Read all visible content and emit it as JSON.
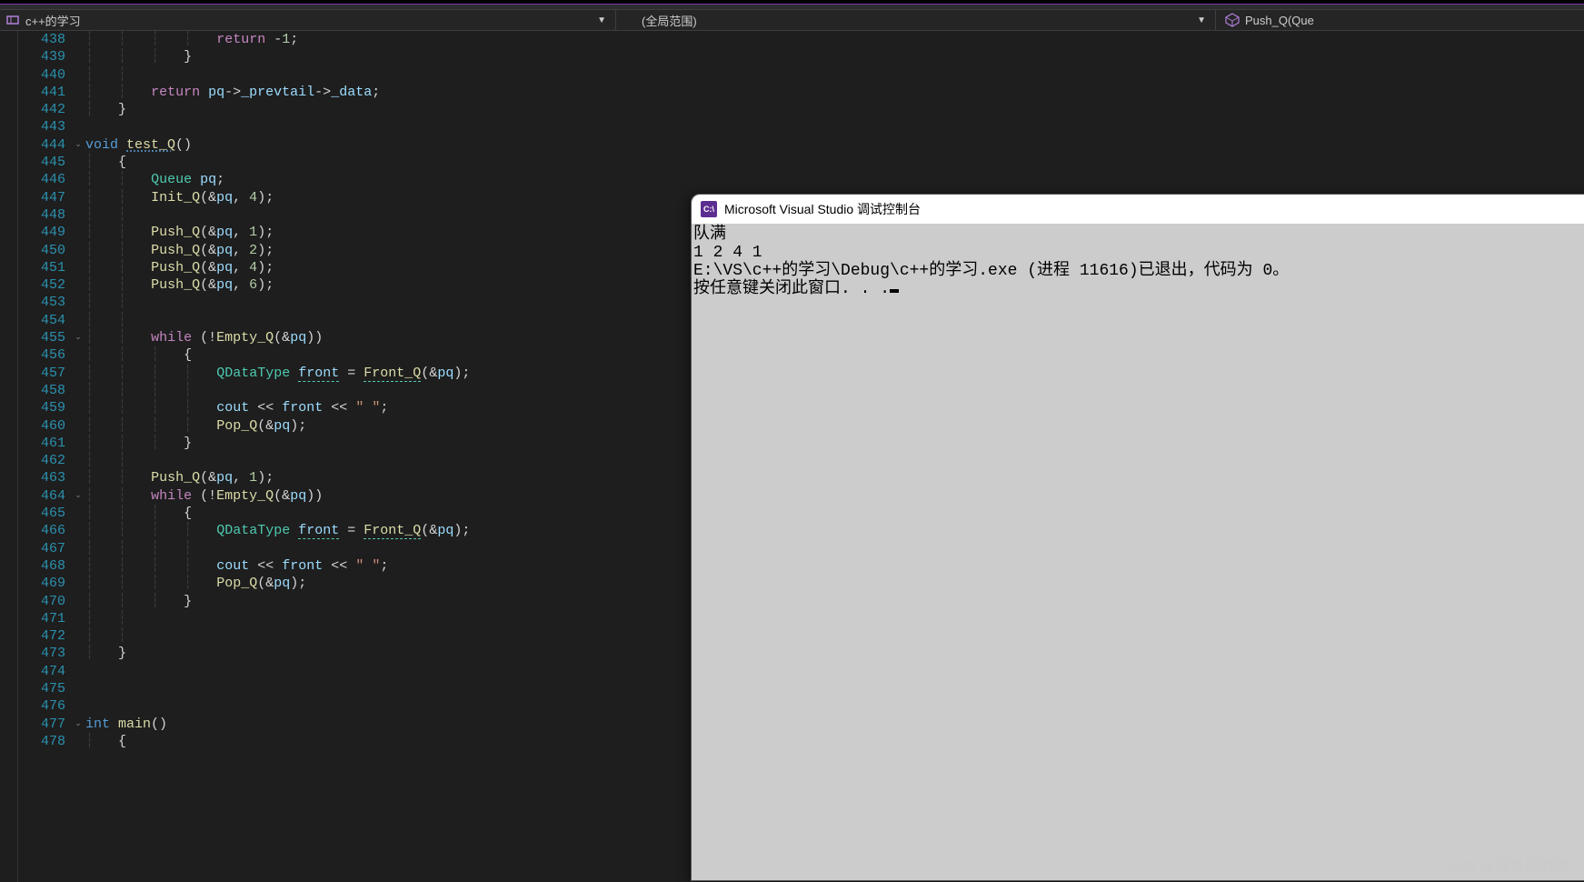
{
  "nav": {
    "project_label": "c++的学习",
    "scope_label": "(全局范围)",
    "member_label": "Push_Q(Que"
  },
  "line_start": 438,
  "code_lines": [
    {
      "n": 438,
      "f": "",
      "g": "||||",
      "tokens": [
        [
          "k-flow",
          "return"
        ],
        [
          "k-punc",
          " "
        ],
        [
          "k-op",
          "-"
        ],
        [
          "k-num",
          "1"
        ],
        [
          "k-punc",
          ";"
        ]
      ]
    },
    {
      "n": 439,
      "f": "",
      "g": "|||",
      "tokens": [
        [
          "k-punc",
          "}"
        ]
      ]
    },
    {
      "n": 440,
      "f": "",
      "g": "||",
      "tokens": []
    },
    {
      "n": 441,
      "f": "",
      "g": "||",
      "tokens": [
        [
          "k-flow",
          "return"
        ],
        [
          "k-punc",
          " "
        ],
        [
          "k-var",
          "pq"
        ],
        [
          "k-op",
          "->"
        ],
        [
          "k-var",
          "_prevtail"
        ],
        [
          "k-op",
          "->"
        ],
        [
          "k-var",
          "_data"
        ],
        [
          "k-punc",
          ";"
        ]
      ]
    },
    {
      "n": 442,
      "f": "",
      "g": "|",
      "tokens": [
        [
          "k-punc",
          "}"
        ]
      ]
    },
    {
      "n": 443,
      "f": "",
      "g": "",
      "tokens": []
    },
    {
      "n": 444,
      "f": "v",
      "g": "",
      "tokens": [
        [
          "k-blue",
          "void"
        ],
        [
          "k-punc",
          " "
        ],
        [
          "k-func k-wavy",
          "test_Q"
        ],
        [
          "k-punc",
          "()"
        ]
      ]
    },
    {
      "n": 445,
      "f": "",
      "g": "|",
      "tokens": [
        [
          "k-punc",
          "{"
        ]
      ]
    },
    {
      "n": 446,
      "f": "",
      "g": "||",
      "tokens": [
        [
          "k-type",
          "Queue"
        ],
        [
          "k-punc",
          " "
        ],
        [
          "k-var",
          "pq"
        ],
        [
          "k-punc",
          ";"
        ]
      ]
    },
    {
      "n": 447,
      "f": "",
      "g": "||",
      "tokens": [
        [
          "k-func",
          "Init_Q"
        ],
        [
          "k-punc",
          "("
        ],
        [
          "k-op",
          "&"
        ],
        [
          "k-var",
          "pq"
        ],
        [
          "k-punc",
          ", "
        ],
        [
          "k-num",
          "4"
        ],
        [
          "k-punc",
          ");"
        ]
      ]
    },
    {
      "n": 448,
      "f": "",
      "g": "||",
      "tokens": []
    },
    {
      "n": 449,
      "f": "",
      "g": "||",
      "tokens": [
        [
          "k-func",
          "Push_Q"
        ],
        [
          "k-punc",
          "("
        ],
        [
          "k-op",
          "&"
        ],
        [
          "k-var",
          "pq"
        ],
        [
          "k-punc",
          ", "
        ],
        [
          "k-num",
          "1"
        ],
        [
          "k-punc",
          ");"
        ]
      ]
    },
    {
      "n": 450,
      "f": "",
      "g": "||",
      "tokens": [
        [
          "k-func",
          "Push_Q"
        ],
        [
          "k-punc",
          "("
        ],
        [
          "k-op",
          "&"
        ],
        [
          "k-var",
          "pq"
        ],
        [
          "k-punc",
          ", "
        ],
        [
          "k-num",
          "2"
        ],
        [
          "k-punc",
          ");"
        ]
      ]
    },
    {
      "n": 451,
      "f": "",
      "g": "||",
      "tokens": [
        [
          "k-func",
          "Push_Q"
        ],
        [
          "k-punc",
          "("
        ],
        [
          "k-op",
          "&"
        ],
        [
          "k-var",
          "pq"
        ],
        [
          "k-punc",
          ", "
        ],
        [
          "k-num",
          "4"
        ],
        [
          "k-punc",
          ");"
        ]
      ]
    },
    {
      "n": 452,
      "f": "",
      "g": "||",
      "tokens": [
        [
          "k-func",
          "Push_Q"
        ],
        [
          "k-punc",
          "("
        ],
        [
          "k-op",
          "&"
        ],
        [
          "k-var",
          "pq"
        ],
        [
          "k-punc",
          ", "
        ],
        [
          "k-num",
          "6"
        ],
        [
          "k-punc",
          ");"
        ]
      ]
    },
    {
      "n": 453,
      "f": "",
      "g": "||",
      "tokens": []
    },
    {
      "n": 454,
      "f": "",
      "g": "||",
      "tokens": []
    },
    {
      "n": 455,
      "f": "v",
      "g": "||",
      "tokens": [
        [
          "k-flow",
          "while"
        ],
        [
          "k-punc",
          " ("
        ],
        [
          "k-op",
          "!"
        ],
        [
          "k-func",
          "Empty_Q"
        ],
        [
          "k-punc",
          "("
        ],
        [
          "k-op",
          "&"
        ],
        [
          "k-var",
          "pq"
        ],
        [
          "k-punc",
          "))"
        ]
      ]
    },
    {
      "n": 456,
      "f": "",
      "g": "|||",
      "tokens": [
        [
          "k-punc",
          "{"
        ]
      ]
    },
    {
      "n": 457,
      "f": "",
      "g": "||||",
      "tokens": [
        [
          "k-type",
          "QDataType"
        ],
        [
          "k-punc",
          " "
        ],
        [
          "k-var k-wavy2",
          "front"
        ],
        [
          "k-punc",
          " "
        ],
        [
          "k-op",
          "="
        ],
        [
          "k-punc",
          " "
        ],
        [
          "k-func k-wavy2",
          "Front_Q"
        ],
        [
          "k-punc",
          "("
        ],
        [
          "k-op",
          "&"
        ],
        [
          "k-var",
          "pq"
        ],
        [
          "k-punc",
          ")"
        ],
        [
          "k-punc",
          ";"
        ]
      ]
    },
    {
      "n": 458,
      "f": "",
      "g": "||||",
      "tokens": []
    },
    {
      "n": 459,
      "f": "",
      "g": "||||",
      "tokens": [
        [
          "k-var",
          "cout"
        ],
        [
          "k-punc",
          " "
        ],
        [
          "k-op",
          "<<"
        ],
        [
          "k-punc",
          " "
        ],
        [
          "k-var",
          "front"
        ],
        [
          "k-punc",
          " "
        ],
        [
          "k-op",
          "<<"
        ],
        [
          "k-punc",
          " "
        ],
        [
          "k-str",
          "\" \""
        ],
        [
          "k-punc",
          ";"
        ]
      ]
    },
    {
      "n": 460,
      "f": "",
      "g": "||||",
      "tokens": [
        [
          "k-func",
          "Pop_Q"
        ],
        [
          "k-punc",
          "("
        ],
        [
          "k-op",
          "&"
        ],
        [
          "k-var",
          "pq"
        ],
        [
          "k-punc",
          ");"
        ]
      ]
    },
    {
      "n": 461,
      "f": "",
      "g": "|||",
      "tokens": [
        [
          "k-punc",
          "}"
        ]
      ]
    },
    {
      "n": 462,
      "f": "",
      "g": "||",
      "tokens": []
    },
    {
      "n": 463,
      "f": "",
      "g": "||",
      "tokens": [
        [
          "k-func",
          "Push_Q"
        ],
        [
          "k-punc",
          "("
        ],
        [
          "k-op",
          "&"
        ],
        [
          "k-var",
          "pq"
        ],
        [
          "k-punc",
          ", "
        ],
        [
          "k-num",
          "1"
        ],
        [
          "k-punc",
          ");"
        ]
      ]
    },
    {
      "n": 464,
      "f": "v",
      "g": "||",
      "tokens": [
        [
          "k-flow",
          "while"
        ],
        [
          "k-punc",
          " ("
        ],
        [
          "k-op",
          "!"
        ],
        [
          "k-func",
          "Empty_Q"
        ],
        [
          "k-punc",
          "("
        ],
        [
          "k-op",
          "&"
        ],
        [
          "k-var",
          "pq"
        ],
        [
          "k-punc",
          "))"
        ]
      ]
    },
    {
      "n": 465,
      "f": "",
      "g": "|||",
      "tokens": [
        [
          "k-punc",
          "{"
        ]
      ]
    },
    {
      "n": 466,
      "f": "",
      "g": "||||",
      "tokens": [
        [
          "k-type",
          "QDataType"
        ],
        [
          "k-punc",
          " "
        ],
        [
          "k-var k-wavy2",
          "front"
        ],
        [
          "k-punc",
          " "
        ],
        [
          "k-op",
          "="
        ],
        [
          "k-punc",
          " "
        ],
        [
          "k-func k-wavy2",
          "Front_Q"
        ],
        [
          "k-punc",
          "("
        ],
        [
          "k-op",
          "&"
        ],
        [
          "k-var",
          "pq"
        ],
        [
          "k-punc",
          ")"
        ],
        [
          "k-punc",
          ";"
        ]
      ]
    },
    {
      "n": 467,
      "f": "",
      "g": "||||",
      "tokens": []
    },
    {
      "n": 468,
      "f": "",
      "g": "||||",
      "tokens": [
        [
          "k-var",
          "cout"
        ],
        [
          "k-punc",
          " "
        ],
        [
          "k-op",
          "<<"
        ],
        [
          "k-punc",
          " "
        ],
        [
          "k-var",
          "front"
        ],
        [
          "k-punc",
          " "
        ],
        [
          "k-op",
          "<<"
        ],
        [
          "k-punc",
          " "
        ],
        [
          "k-str",
          "\" \""
        ],
        [
          "k-punc",
          ";"
        ]
      ]
    },
    {
      "n": 469,
      "f": "",
      "g": "||||",
      "tokens": [
        [
          "k-func",
          "Pop_Q"
        ],
        [
          "k-punc",
          "("
        ],
        [
          "k-op",
          "&"
        ],
        [
          "k-var",
          "pq"
        ],
        [
          "k-punc",
          ");"
        ]
      ]
    },
    {
      "n": 470,
      "f": "",
      "g": "|||",
      "tokens": [
        [
          "k-punc",
          "}"
        ]
      ]
    },
    {
      "n": 471,
      "f": "",
      "g": "||",
      "tokens": []
    },
    {
      "n": 472,
      "f": "",
      "g": "||",
      "tokens": []
    },
    {
      "n": 473,
      "f": "",
      "g": "|",
      "tokens": [
        [
          "k-punc",
          "}"
        ]
      ]
    },
    {
      "n": 474,
      "f": "",
      "g": "",
      "tokens": []
    },
    {
      "n": 475,
      "f": "",
      "g": "",
      "tokens": []
    },
    {
      "n": 476,
      "f": "",
      "g": "",
      "tokens": []
    },
    {
      "n": 477,
      "f": "v",
      "g": "",
      "tokens": [
        [
          "k-blue",
          "int"
        ],
        [
          "k-punc",
          " "
        ],
        [
          "k-func",
          "main"
        ],
        [
          "k-punc",
          "()"
        ]
      ]
    },
    {
      "n": 478,
      "f": "",
      "g": "|",
      "tokens": [
        [
          "k-punc",
          "{"
        ]
      ]
    }
  ],
  "console": {
    "title": "Microsoft Visual Studio 调试控制台",
    "lines": [
      "队满",
      "1 2 4 1",
      "E:\\VS\\c++的学习\\Debug\\c++的学习.exe (进程 11616)已退出，代码为 0。",
      "按任意键关闭此窗口. . ."
    ]
  },
  "watermark": "CSDN @打鱼又晒网"
}
